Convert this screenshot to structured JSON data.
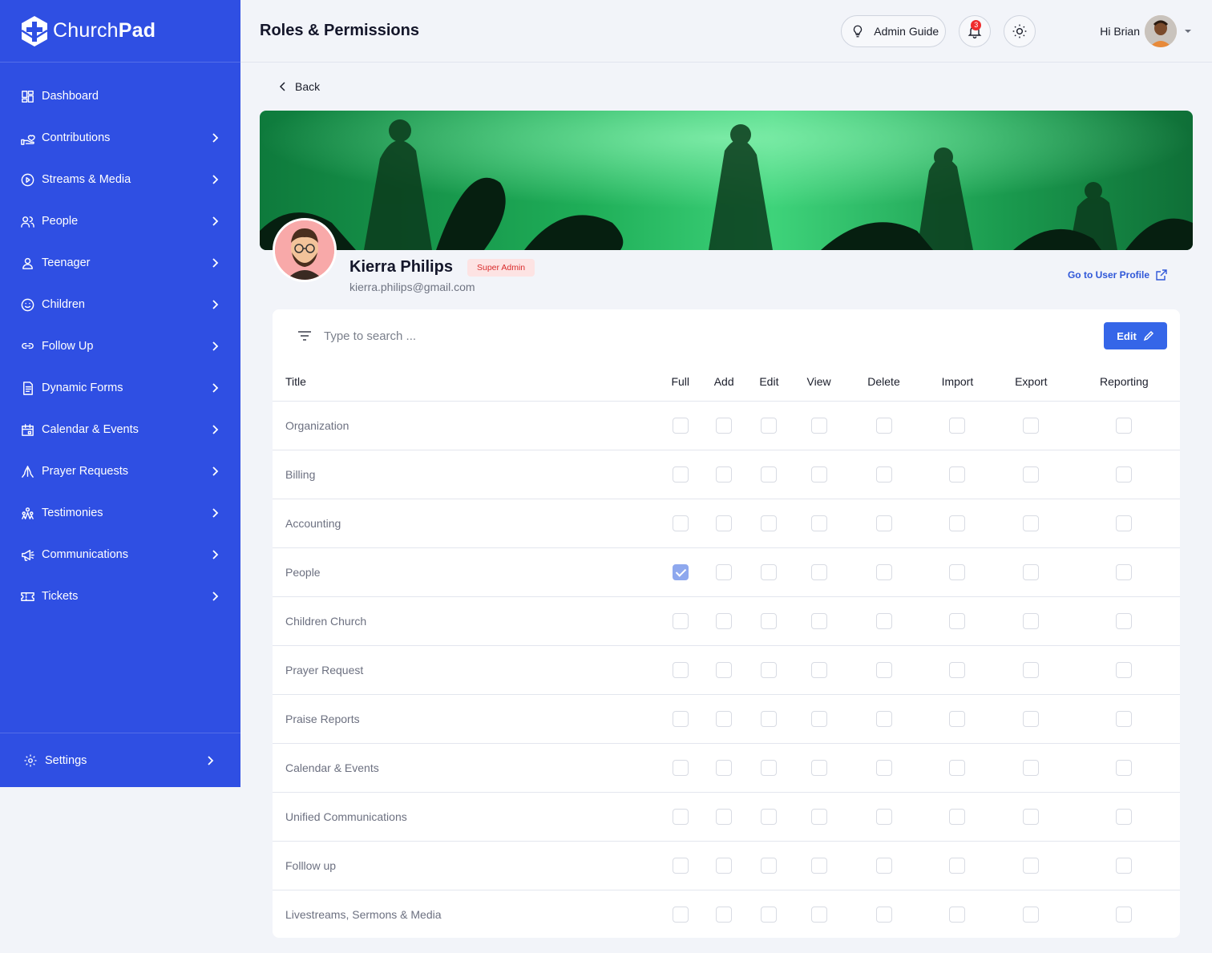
{
  "brand": {
    "name_light": "Church",
    "name_bold": "Pad"
  },
  "sidebar": {
    "items": [
      {
        "label": "Dashboard",
        "icon": "dashboard-icon",
        "has_submenu": false
      },
      {
        "label": "Contributions",
        "icon": "hand-heart-icon",
        "has_submenu": true
      },
      {
        "label": "Streams & Media",
        "icon": "play-circle-icon",
        "has_submenu": true
      },
      {
        "label": "People",
        "icon": "users-icon",
        "has_submenu": true
      },
      {
        "label": "Teenager",
        "icon": "user-icon",
        "has_submenu": true
      },
      {
        "label": "Children",
        "icon": "smiley-icon",
        "has_submenu": true
      },
      {
        "label": "Follow Up",
        "icon": "link-icon",
        "has_submenu": true
      },
      {
        "label": "Dynamic Forms",
        "icon": "form-icon",
        "has_submenu": true
      },
      {
        "label": "Calendar & Events",
        "icon": "calendar-icon",
        "has_submenu": true
      },
      {
        "label": "Prayer Requests",
        "icon": "praying-hands-icon",
        "has_submenu": true
      },
      {
        "label": "Testimonies",
        "icon": "group-icon",
        "has_submenu": true
      },
      {
        "label": "Communications",
        "icon": "megaphone-icon",
        "has_submenu": true
      },
      {
        "label": "Tickets",
        "icon": "ticket-icon",
        "has_submenu": true
      }
    ],
    "settings_label": "Settings"
  },
  "header": {
    "title": "Roles & Permissions",
    "guide_label": "Admin Guide",
    "notification_count": "3",
    "greeting": "Hi Brian"
  },
  "main": {
    "back_label": "Back",
    "profile": {
      "name": "Kierra Philips",
      "role": "Super Admin",
      "email": "kierra.philips@gmail.com",
      "link_label": "Go to User Profile"
    },
    "search": {
      "placeholder": "Type to search ..."
    },
    "edit_label": "Edit"
  },
  "permissions": {
    "columns": [
      "Title",
      "Full",
      "Add",
      "Edit",
      "View",
      "Delete",
      "Import",
      "Export",
      "Reporting"
    ],
    "rows": [
      {
        "title": "Organization",
        "checked": [
          false,
          false,
          false,
          false,
          false,
          false,
          false,
          false
        ]
      },
      {
        "title": "Billing",
        "checked": [
          false,
          false,
          false,
          false,
          false,
          false,
          false,
          false
        ]
      },
      {
        "title": "Accounting",
        "checked": [
          false,
          false,
          false,
          false,
          false,
          false,
          false,
          false
        ]
      },
      {
        "title": "People",
        "checked": [
          true,
          false,
          false,
          false,
          false,
          false,
          false,
          false
        ]
      },
      {
        "title": "Children Church",
        "checked": [
          false,
          false,
          false,
          false,
          false,
          false,
          false,
          false
        ]
      },
      {
        "title": "Prayer Request",
        "checked": [
          false,
          false,
          false,
          false,
          false,
          false,
          false,
          false
        ]
      },
      {
        "title": "Praise Reports",
        "checked": [
          false,
          false,
          false,
          false,
          false,
          false,
          false,
          false
        ]
      },
      {
        "title": "Calendar & Events",
        "checked": [
          false,
          false,
          false,
          false,
          false,
          false,
          false,
          false
        ]
      },
      {
        "title": "Unified Communications",
        "checked": [
          false,
          false,
          false,
          false,
          false,
          false,
          false,
          false
        ]
      },
      {
        "title": "Folllow up",
        "checked": [
          false,
          false,
          false,
          false,
          false,
          false,
          false,
          false
        ]
      },
      {
        "title": "Livestreams, Sermons & Media",
        "checked": [
          false,
          false,
          false,
          false,
          false,
          false,
          false,
          false
        ]
      }
    ]
  },
  "colors": {
    "sidebar": "#2f4fe3",
    "accent": "#3566e8",
    "checked": "#8ea8ee",
    "badge_bg": "#fde3e3",
    "badge_text": "#d92c2c"
  }
}
